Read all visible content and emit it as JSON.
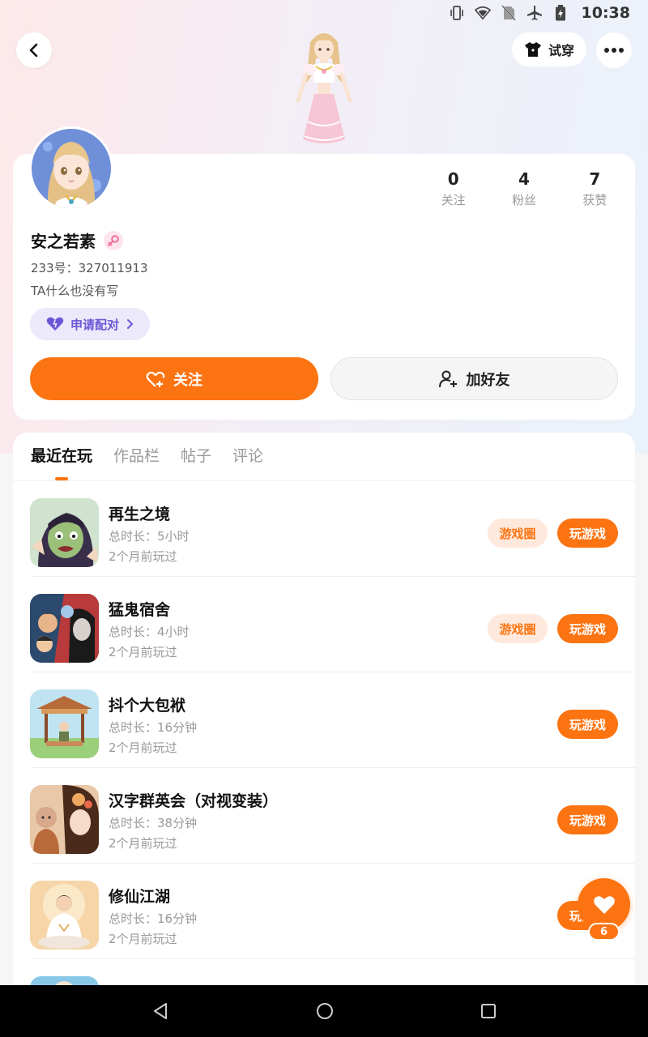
{
  "status_bar": {
    "time": "10:38",
    "icons": [
      "vibrate-icon",
      "wifi-icon",
      "no-sim-icon",
      "airplane-icon",
      "battery-icon"
    ]
  },
  "header": {
    "tryon_label": "试穿"
  },
  "profile": {
    "stats": [
      {
        "value": "0",
        "label": "关注"
      },
      {
        "value": "4",
        "label": "粉丝"
      },
      {
        "value": "7",
        "label": "获赞"
      }
    ],
    "username": "安之若素",
    "user_id": "233号：327011913",
    "bio": "TA什么也没有写",
    "pair_label": "申请配对",
    "follow_label": "关注",
    "add_friend_label": "加好友"
  },
  "tabs": [
    {
      "label": "最近在玩",
      "active": true
    },
    {
      "label": "作品栏",
      "active": false
    },
    {
      "label": "帖子",
      "active": false
    },
    {
      "label": "评论",
      "active": false
    }
  ],
  "games": [
    {
      "name": "再生之境",
      "duration": "总时长：5小时",
      "last_played": "2个月前玩过",
      "circle_label": "游戏圈",
      "play_label": "玩游戏"
    },
    {
      "name": "猛鬼宿舍",
      "duration": "总时长：4小时",
      "last_played": "2个月前玩过",
      "circle_label": "游戏圈",
      "play_label": "玩游戏"
    },
    {
      "name": "抖个大包袱",
      "duration": "总时长：16分钟",
      "last_played": "2个月前玩过",
      "play_label": "玩游戏"
    },
    {
      "name": "汉字群英会（对视变装）",
      "duration": "总时长：38分钟",
      "last_played": "2个月前玩过",
      "play_label": "玩游戏"
    },
    {
      "name": "修仙江湖",
      "duration": "总时长：16分钟",
      "last_played": "2个月前玩过",
      "play_label": "玩游戏"
    }
  ],
  "like_fab": {
    "count": "6"
  },
  "colors": {
    "accent": "#fc7412",
    "accent_light": "#fee9dc",
    "pair_bg": "#ece9fb",
    "pair_text": "#6b57d6"
  }
}
